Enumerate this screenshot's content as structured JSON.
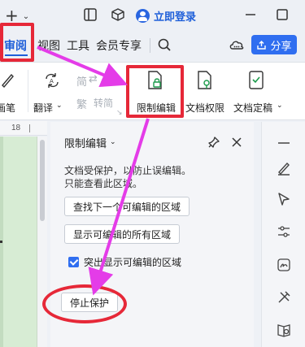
{
  "titlebar": {
    "add_icon": "plus-icon",
    "add_label": "+",
    "login_label": "立即登录"
  },
  "menu": {
    "tabs": [
      "审阅",
      "视图",
      "工具",
      "会员专享"
    ],
    "active_tab": "审阅",
    "share_label": "分享"
  },
  "ribbon": {
    "pen_label": "画笔",
    "translate_label": "翻译",
    "simplified_label": "简",
    "traditional_label": "繁",
    "convert_label": "转简",
    "restrict_edit_label": "限制编辑",
    "doc_permission_label": "文档权限",
    "doc_finalize_label": "文档定稿"
  },
  "ruler": {
    "number": "18"
  },
  "panel": {
    "title": "限制编辑",
    "description_line1": "文档受保护，以防止误编辑。",
    "description_line2": "只能查看此区域。",
    "find_next_button": "查找下一个可编辑的区域",
    "show_all_button": "显示可编辑的所有区域",
    "highlight_checkbox_label": "突出显示可编辑的区域",
    "highlight_checked": true,
    "stop_protection_button": "停止保护"
  },
  "colors": {
    "accent": "#2f6ef0",
    "annotation_red": "#e62838",
    "annotation_magenta": "#e43ce8",
    "doc_background": "#d7ecd4"
  }
}
